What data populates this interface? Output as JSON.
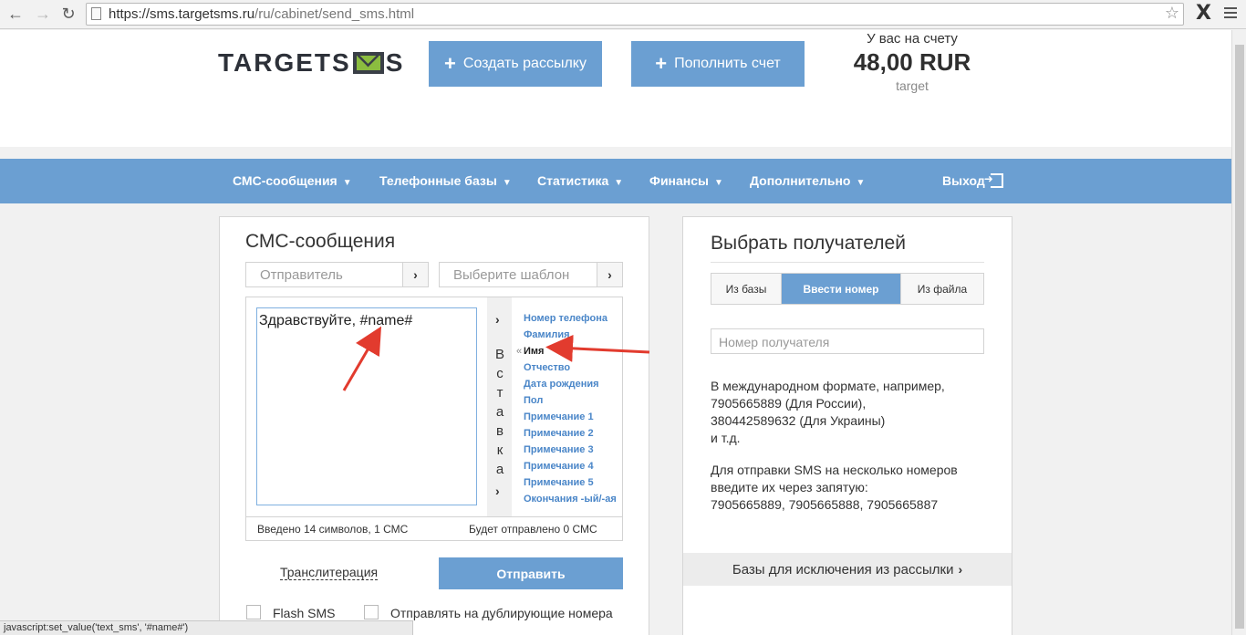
{
  "browser": {
    "url_prefix": "https://sms.targetsms.ru",
    "url_path": "/ru/cabinet/send_sms.html",
    "status_text": "javascript:set_value('text_sms', '#name#')"
  },
  "header": {
    "logo_left": "TARGETS",
    "logo_right": "S",
    "create_label": "Создать рассылку",
    "topup_label": "Пополнить счет",
    "balance_label": "У вас на счету",
    "balance_amount": "48,00 RUR",
    "username": "target"
  },
  "menu": {
    "items": [
      "СМС-сообщения",
      "Телефонные базы",
      "Статистика",
      "Финансы",
      "Дополнительно"
    ],
    "logout": "Выход"
  },
  "sms_panel": {
    "title": "СМС-сообщения",
    "sender_placeholder": "Отправитель",
    "template_placeholder": "Выберите шаблон",
    "message_text": "Здравствуйте, #name#",
    "insert_letters": [
      "В",
      "с",
      "т",
      "а",
      "в",
      "к",
      "а"
    ],
    "variables": [
      "Номер телефона",
      "Фамилия",
      "Имя",
      "Отчество",
      "Дата рождения",
      "Пол",
      "Примечание 1",
      "Примечание 2",
      "Примечание 3",
      "Примечание 4",
      "Примечание 5",
      "Окончания -ый/-ая"
    ],
    "active_variable": "Имя",
    "counter_entered": "Введено 14 символов, 1 СМС",
    "counter_sent": "Будет отправлено 0 СМС",
    "translit_label": "Транслитерация",
    "send_label": "Отправить",
    "flash_label": "Flash SMS",
    "duplicate_label": "Отправлять на дублирующие номера"
  },
  "recipients_panel": {
    "title": "Выбрать получателей",
    "tabs": [
      "Из базы",
      "Ввести номер",
      "Из файла"
    ],
    "active_tab": "Ввести номер",
    "number_placeholder": "Номер получателя",
    "help1": [
      "В международном формате, например,",
      "7905665889 (Для России),",
      "380442589632 (Для Украины)",
      "и т.д."
    ],
    "help2": [
      "Для отправки SMS на несколько номеров",
      "введите их через запятую:",
      "7905665889, 7905665888, 7905665887"
    ],
    "exclude_label": "Базы для исключения из рассылки"
  },
  "colors": {
    "accent": "#6b9fd2",
    "link": "#4a86c8",
    "arrow": "#e23b2e"
  }
}
